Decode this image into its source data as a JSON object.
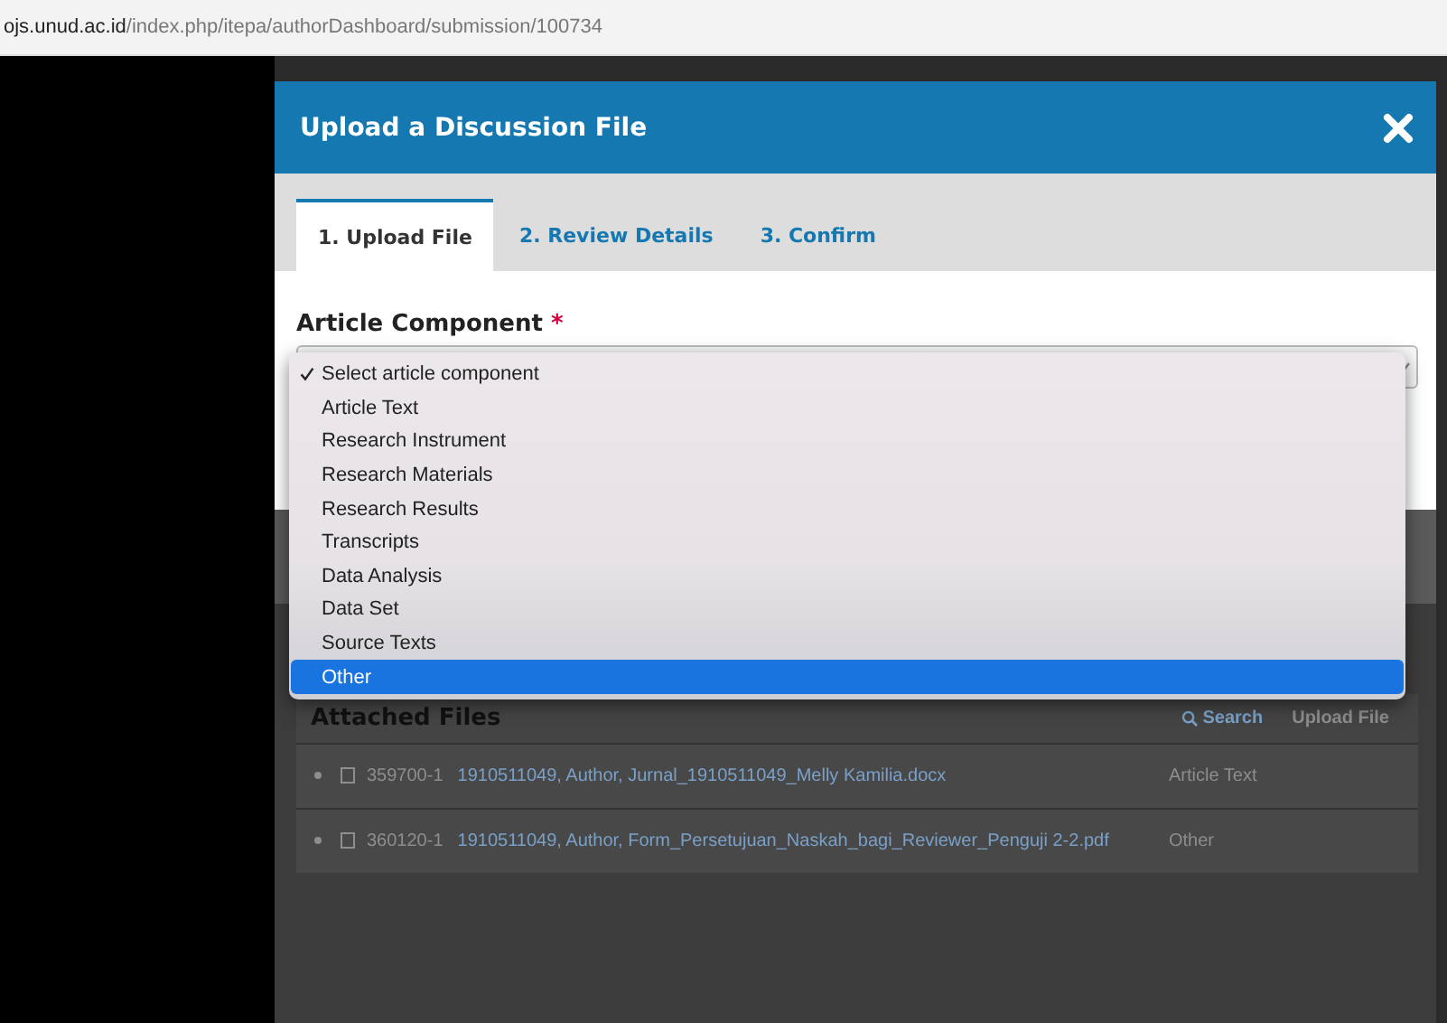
{
  "address_bar": {
    "host": "ojs.unud.ac.id",
    "path": "/index.php/itepa/authorDashboard/submission/100734"
  },
  "modal": {
    "title": "Upload a Discussion File",
    "tabs": [
      {
        "label": "1. Upload File",
        "selected": true
      },
      {
        "label": "2. Review Details",
        "selected": false
      },
      {
        "label": "3. Confirm",
        "selected": false
      }
    ],
    "field": {
      "label": "Article Component",
      "required_mark": "*"
    },
    "dropdown": {
      "options": [
        {
          "label": "Select article component",
          "checked": true,
          "selected": false
        },
        {
          "label": "Article Text",
          "checked": false,
          "selected": false
        },
        {
          "label": "Research Instrument",
          "checked": false,
          "selected": false
        },
        {
          "label": "Research Materials",
          "checked": false,
          "selected": false
        },
        {
          "label": "Research Results",
          "checked": false,
          "selected": false
        },
        {
          "label": "Transcripts",
          "checked": false,
          "selected": false
        },
        {
          "label": "Data Analysis",
          "checked": false,
          "selected": false
        },
        {
          "label": "Data Set",
          "checked": false,
          "selected": false
        },
        {
          "label": "Source Texts",
          "checked": false,
          "selected": false
        },
        {
          "label": "Other",
          "checked": false,
          "selected": true
        }
      ]
    },
    "attached_files": {
      "title": "Attached Files",
      "search": "Search",
      "upload": "Upload File",
      "rows": [
        {
          "id": "359700-1",
          "name": "1910511049, Author, Jurnal_1910511049_Melly Kamilia.docx",
          "genre": "Article Text"
        },
        {
          "id": "360120-1",
          "name": "1910511049, Author, Form_Persetujuan_Naskah_bagi_Reviewer_Penguji 2-2.pdf",
          "genre": "Other"
        }
      ]
    }
  }
}
